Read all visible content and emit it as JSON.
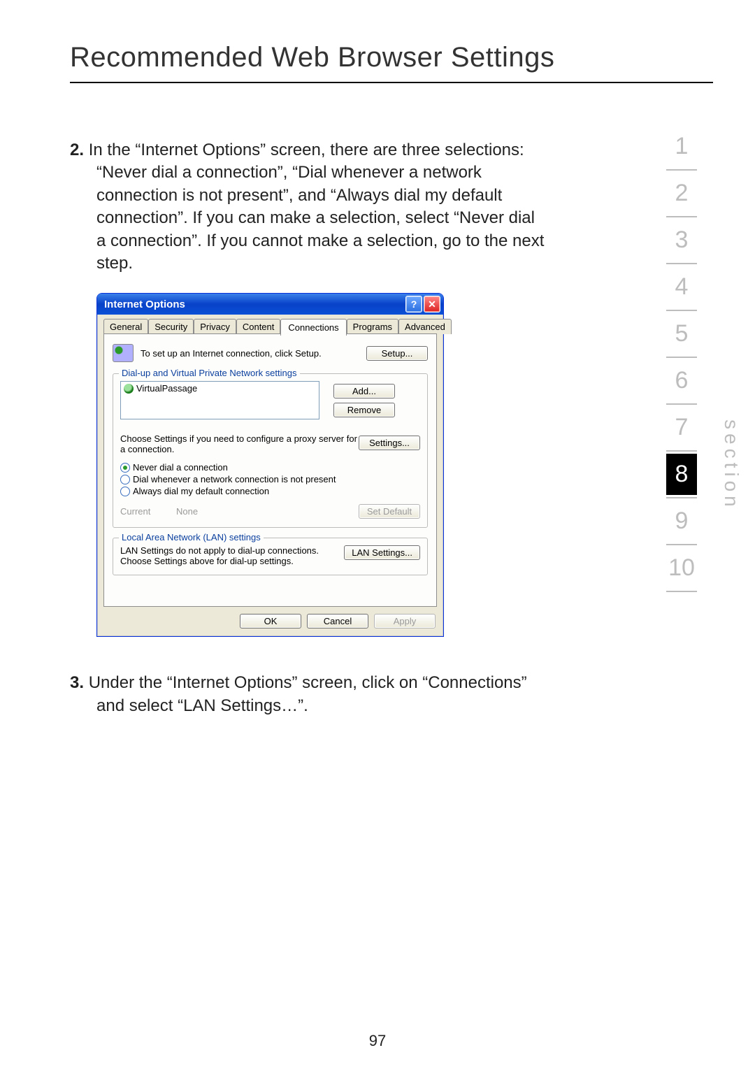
{
  "page": {
    "title": "Recommended Web Browser Settings",
    "number": "97"
  },
  "section_label": "section",
  "nav": {
    "items": [
      "1",
      "2",
      "3",
      "4",
      "5",
      "6",
      "7",
      "8",
      "9",
      "10"
    ],
    "active_index": 7
  },
  "steps": {
    "s2_num": "2.",
    "s2_text": "In the “Internet Options” screen, there are three selections: “Never dial a connection”, “Dial whenever a network connection is not present”, and “Always dial my default connection”. If you can make a selection, select “Never dial a connection”. If you cannot make a selection, go to the next step.",
    "s3_num": "3.",
    "s3_text": "Under the “Internet Options” screen, click on “Connections” and select “LAN Settings…”."
  },
  "dialog": {
    "title": "Internet Options",
    "help_btn": "?",
    "close_btn": "✕",
    "tabs": [
      "General",
      "Security",
      "Privacy",
      "Content",
      "Connections",
      "Programs",
      "Advanced"
    ],
    "active_tab": "Connections",
    "setup_text": "To set up an Internet connection, click Setup.",
    "setup_btn": "Setup...",
    "group_dialup": "Dial-up and Virtual Private Network settings",
    "conn_item": "VirtualPassage",
    "add_btn": "Add...",
    "remove_btn": "Remove",
    "proxy_note": "Choose Settings if you need to configure a proxy server for a connection.",
    "settings_btn": "Settings...",
    "radio1": "Never dial a connection",
    "radio2": "Dial whenever a network connection is not present",
    "radio3": "Always dial my default connection",
    "current_label": "Current",
    "current_value": "None",
    "set_default_btn": "Set Default",
    "group_lan": "Local Area Network (LAN) settings",
    "lan_note": "LAN Settings do not apply to dial-up connections. Choose Settings above for dial-up settings.",
    "lan_btn": "LAN Settings...",
    "ok_btn": "OK",
    "cancel_btn": "Cancel",
    "apply_btn": "Apply"
  }
}
